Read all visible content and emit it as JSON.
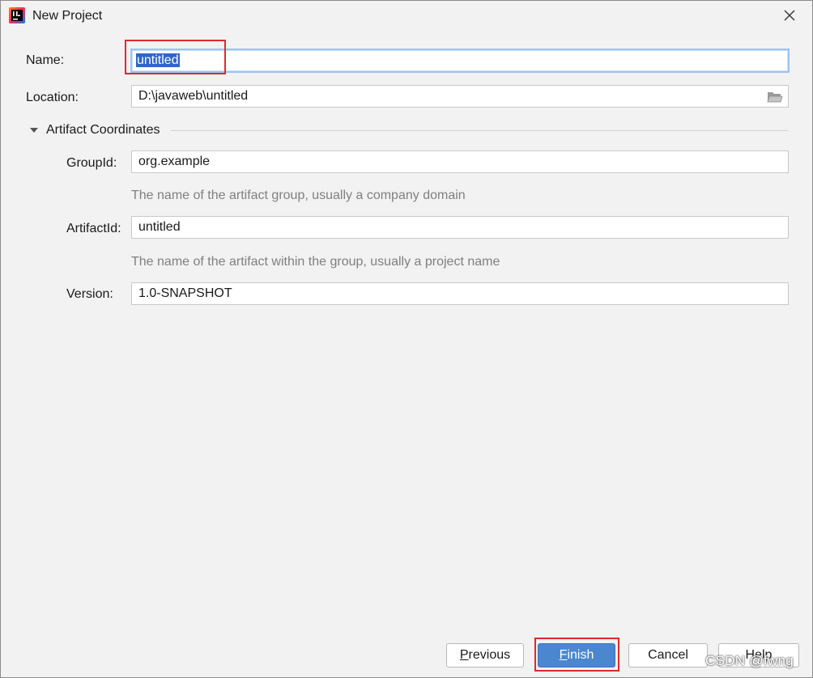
{
  "window": {
    "title": "New Project",
    "icon": "intellij-idea-icon",
    "close_icon": "close-icon"
  },
  "form": {
    "name": {
      "label": "Name:",
      "value": "untitled"
    },
    "location": {
      "label": "Location:",
      "value": "D:\\javaweb\\untitled",
      "icon": "folder-icon"
    }
  },
  "artifact": {
    "section_label": "Artifact Coordinates",
    "expanded": true,
    "group_id": {
      "label": "GroupId:",
      "value": "org.example",
      "hint": "The name of the artifact group, usually a company domain"
    },
    "artifact_id": {
      "label": "ArtifactId:",
      "value": "untitled",
      "hint": "The name of the artifact within the group, usually a project name"
    },
    "version": {
      "label": "Version:",
      "value": "1.0-SNAPSHOT"
    }
  },
  "buttons": {
    "previous": {
      "mnemonic": "P",
      "rest": "revious"
    },
    "finish": {
      "mnemonic": "F",
      "rest": "inish"
    },
    "cancel": "Cancel",
    "help": "Help"
  },
  "watermark": "CSDN @fwng",
  "colors": {
    "accent": "#4a87cf",
    "selection": "#2f65ca",
    "highlight": "#e0292e",
    "background": "#f2f2f2"
  }
}
